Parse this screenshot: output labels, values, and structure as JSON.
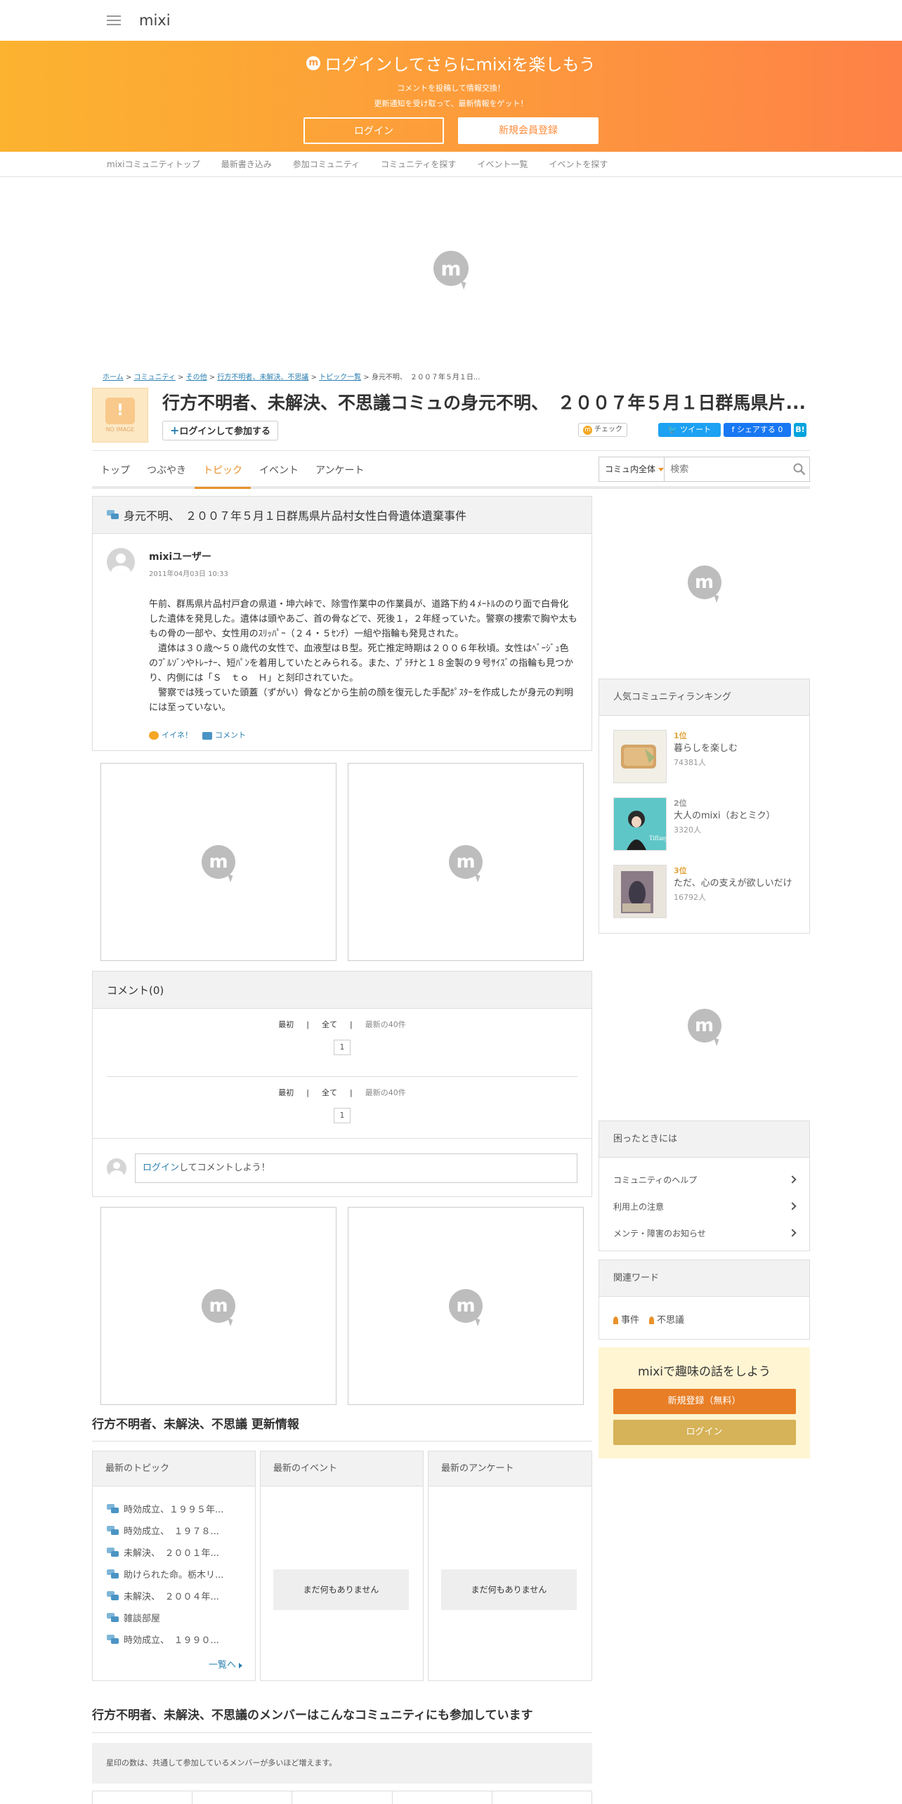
{
  "header": {
    "logo": "mixi"
  },
  "hero": {
    "title": "ログインしてさらにmixiを楽しもう",
    "icon": "m",
    "line1": "コメントを投稿して情報交換！",
    "line2": "更新通知を受け取って、最新情報をゲット！",
    "login": "ログイン",
    "register": "新規会員登録"
  },
  "subnav": [
    "mixiコミュニティトップ",
    "最新書き込み",
    "参加コミュニティ",
    "コミュニティを探す",
    "イベント一覧",
    "イベントを探す"
  ],
  "ad_logo": "m",
  "breadcrumb": {
    "home": "ホーム",
    "community": "コミュニティ",
    "other": "その他",
    "comm": "行方不明者、未解決、不思議",
    "topics": "トピック一覧",
    "current": "身元不明、　２００７年５月１日..."
  },
  "community": {
    "noimage": "NO IMAGE",
    "title": "行方不明者、未解決、不思議コミュの身元不明、　２００７年５月１日群馬県片...",
    "join": "ログインして参加する",
    "check": "チェック",
    "tweet": "ツイート",
    "share": "シェアする 0",
    "hatena": "B!"
  },
  "tabs": [
    "トップ",
    "つぶやき",
    "トピック",
    "イベント",
    "アンケート"
  ],
  "search": {
    "scope": "コミュ内全体",
    "placeholder": "検索"
  },
  "topic": {
    "title": "身元不明、　２００７年５月１日群馬県片品村女性白骨遺体遺棄事件",
    "author": "mixiユーザー",
    "date": "2011年04月03日 10:33",
    "body": "午前、群馬県片品村戸倉の県道・坤六峠で、除雪作業中の作業員が、道路下約４ﾒｰﾄﾙののり面で白骨化した遺体を発見した。遺体は頭やあご、首の骨などで、死後１，２年経っていた。警察の捜索で胸や太ももの骨の一部や、女性用のｽﾘｯﾊﾟｰ（２４・５ｾﾝﾁ）一組や指輪も発見された。\n　遺体は３０歳～５０歳代の女性で、血液型はＢ型。死亡推定時期は２００６年秋頃。女性はﾍﾞｰｼﾞｭ色のﾌﾞﾙｿﾞﾝやﾄﾚｰﾅｰ、短ﾊﾟﾝを着用していたとみられる。また、ﾌﾟﾗﾁﾅと１８金製の９号ｻｲｽﾞの指輪も見つかり、内側には「Ｓ　ｔｏ　Ｈ」と刻印されていた。\n　警察では残っていた頭蓋（ずがい）骨などから生前の顔を復元した手配ﾎﾟｽﾀｰを作成したが身元の判明には至っていない。",
    "iine": "イイネ！",
    "comment": "コメント"
  },
  "comments": {
    "title": "コメント(0)",
    "first": "最初",
    "all": "全て",
    "latest": "最新の40件",
    "page": "1",
    "sep": "|",
    "login_link": "ログイン",
    "login_rest": "してコメントしよう！"
  },
  "ranking": {
    "title": "人気コミュニティランキング",
    "items": [
      {
        "pos": "1位",
        "name": "暮らしを楽しむ",
        "count": "74381人"
      },
      {
        "pos": "2位",
        "name": "大人のmixi（おとミク）",
        "count": "3320人"
      },
      {
        "pos": "3位",
        "name": "ただ、心の支えが欲しいだけ",
        "count": "16792人"
      }
    ]
  },
  "help": {
    "title": "困ったときには",
    "items": [
      "コミュニティのヘルプ",
      "利用上の注意",
      "メンテ・障害のお知らせ"
    ]
  },
  "related": {
    "title": "関連ワード",
    "words": [
      "事件",
      "不思議"
    ]
  },
  "promo": {
    "title": "mixiで趣味の話をしよう",
    "register": "新規登録（無料）",
    "login": "ログイン"
  },
  "updates": {
    "title": "行方不明者、未解決、不思議 更新情報",
    "topics_title": "最新のトピック",
    "topics": [
      "時効成立、１９９５年...",
      "時効成立、　１９７８...",
      "未解決、　２００１年...",
      "助けられた命。栃木リ...",
      "未解決、　２００４年...",
      "雑談部屋",
      "時効成立、　１９９０..."
    ],
    "more": "一覧へ",
    "events_title": "最新のイベント",
    "surveys_title": "最新のアンケート",
    "empty": "まだ何もありません"
  },
  "members": {
    "title": "行方不明者、未解決、不思議のメンバーはこんなコミュニティにも参加しています",
    "note": "星印の数は、共通して参加しているメンバーが多いほど増えます。"
  }
}
